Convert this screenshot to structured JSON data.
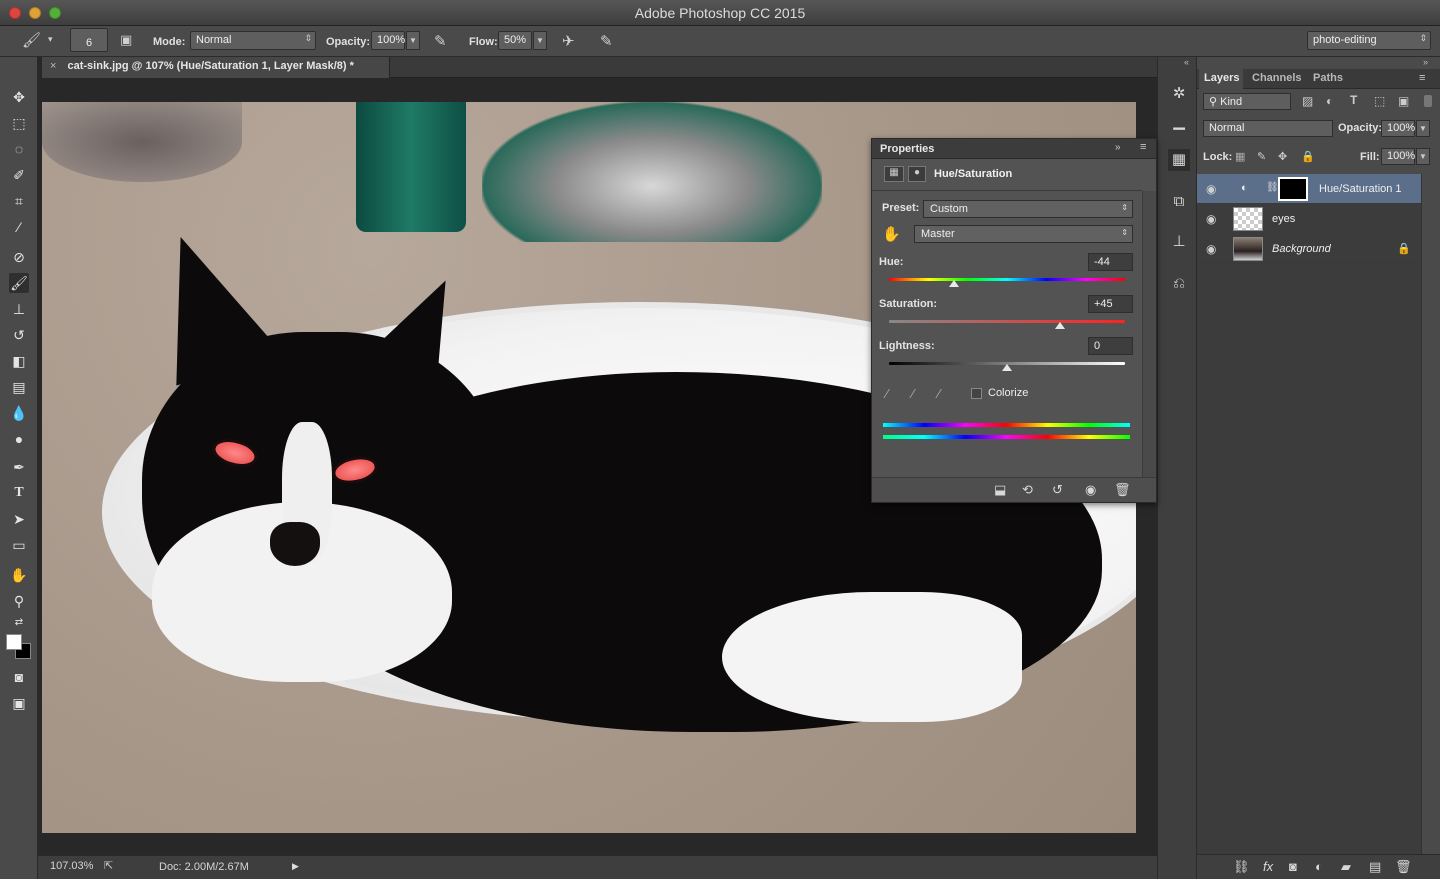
{
  "window": {
    "title": "Adobe Photoshop CC 2015"
  },
  "options_bar": {
    "brush_size": "6",
    "mode_label": "Mode:",
    "mode_value": "Normal",
    "opacity_label": "Opacity:",
    "opacity_value": "100%",
    "flow_label": "Flow:",
    "flow_value": "50%",
    "workspace": "photo-editing"
  },
  "document": {
    "tab_title": "cat-sink.jpg @ 107% (Hue/Saturation 1, Layer Mask/8) *",
    "close_glyph": "×"
  },
  "status": {
    "zoom": "107.03%",
    "doc_size": "Doc: 2.00M/2.67M"
  },
  "properties": {
    "panel_title": "Properties",
    "adjustment_name": "Hue/Saturation",
    "preset_label": "Preset:",
    "preset_value": "Custom",
    "channel_value": "Master",
    "hue_label": "Hue:",
    "hue_value": "-44",
    "saturation_label": "Saturation:",
    "saturation_value": "+45",
    "lightness_label": "Lightness:",
    "lightness_value": "0",
    "colorize_label": "Colorize",
    "colorize_checked": false
  },
  "layers_panel": {
    "tabs": [
      "Layers",
      "Channels",
      "Paths"
    ],
    "filter_kind": "Kind",
    "blend_mode": "Normal",
    "opacity_label": "Opacity:",
    "opacity_value": "100%",
    "lock_label": "Lock:",
    "fill_label": "Fill:",
    "fill_value": "100%",
    "layers": [
      {
        "name": "Hue/Saturation 1",
        "selected": true
      },
      {
        "name": "eyes",
        "selected": false
      },
      {
        "name": "Background",
        "selected": false,
        "locked": true
      }
    ]
  },
  "icons": {
    "tools": [
      "move-tool-icon",
      "marquee-tool-icon",
      "lasso-tool-icon",
      "quick-selection-tool-icon",
      "crop-tool-icon",
      "eyedropper-tool-icon",
      "healing-brush-tool-icon",
      "brush-tool-icon",
      "clone-stamp-tool-icon",
      "history-brush-tool-icon",
      "eraser-tool-icon",
      "gradient-tool-icon",
      "blur-tool-icon",
      "dodge-tool-icon",
      "pen-tool-icon",
      "type-tool-icon",
      "path-selection-tool-icon",
      "rectangle-tool-icon",
      "hand-tool-icon",
      "zoom-tool-icon"
    ]
  },
  "colors": {
    "selected_layer": "#5b6e8a",
    "panel_bg": "#4a4a4a",
    "eye_red": "#e64545"
  }
}
